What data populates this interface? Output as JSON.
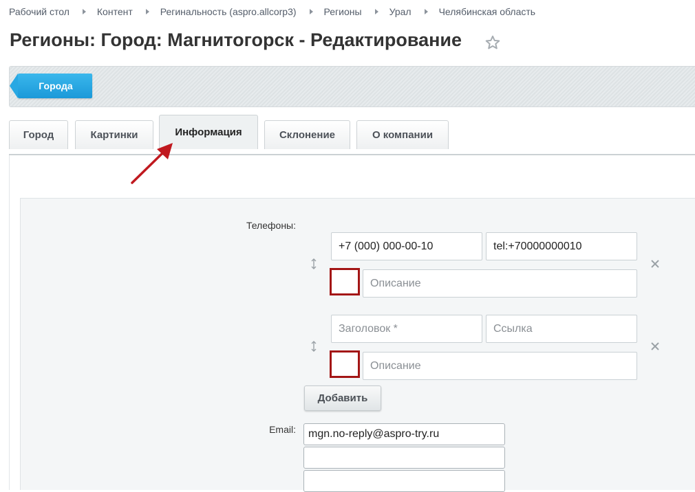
{
  "breadcrumbs": [
    {
      "label": "Рабочий стол"
    },
    {
      "label": "Контент"
    },
    {
      "label": "Регинальность (aspro.allcorp3)"
    },
    {
      "label": "Регионы"
    },
    {
      "label": "Урал"
    },
    {
      "label": "Челябинская область"
    }
  ],
  "page": {
    "title": "Регионы: Город: Магнитогорск - Редактирование",
    "favorite_icon": "star-icon"
  },
  "toolbar": {
    "back_label": "Города",
    "back_color": "#1b99d9"
  },
  "tabs": [
    {
      "label": "Город",
      "active": false
    },
    {
      "label": "Картинки",
      "active": false
    },
    {
      "label": "Информация",
      "active": true
    },
    {
      "label": "Склонение",
      "active": false
    },
    {
      "label": "О компании",
      "active": false
    }
  ],
  "form": {
    "phones_label": "Телефоны:",
    "phones": [
      {
        "title_value": "+7 (000) 000-00-10",
        "title_placeholder": "Заголовок *",
        "link_value": "tel:+70000000010",
        "link_placeholder": "Ссылка",
        "description_value": "",
        "description_placeholder": "Описание"
      },
      {
        "title_value": "",
        "title_placeholder": "Заголовок *",
        "link_value": "",
        "link_placeholder": "Ссылка",
        "description_value": "",
        "description_placeholder": "Описание"
      }
    ],
    "add_label": "Добавить",
    "email_label": "Email:",
    "emails": [
      "mgn.no-reply@aspro-try.ru",
      "",
      ""
    ]
  },
  "annotation_color": "#c0191f"
}
